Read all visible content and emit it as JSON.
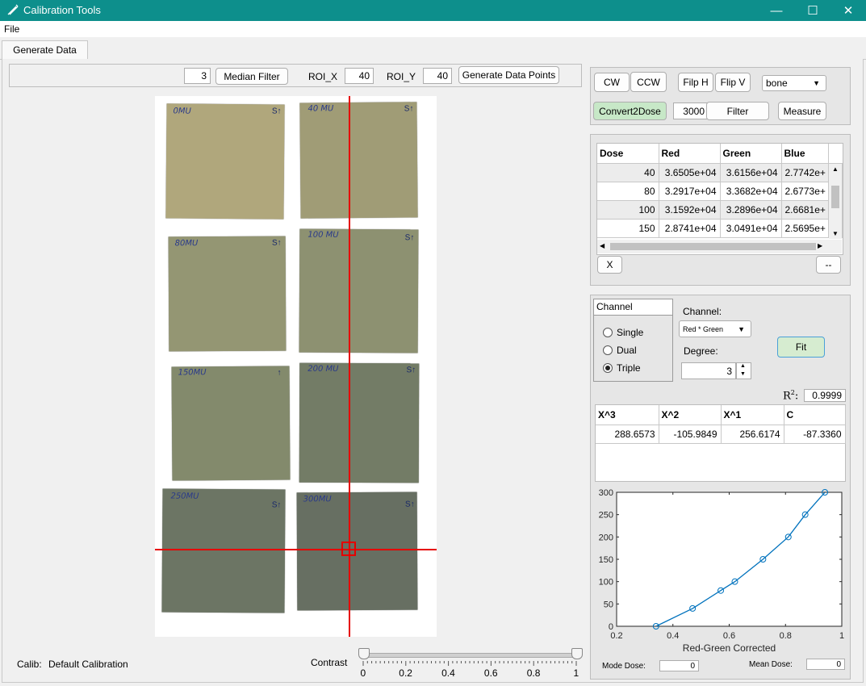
{
  "window": {
    "title": "Calibration Tools",
    "minimize": "—",
    "maximize": "☐",
    "close": "✕"
  },
  "menu": {
    "file": "File"
  },
  "tabs": [
    {
      "label": "Generate Data"
    }
  ],
  "toolbar": {
    "median_value": "3",
    "median_filter": "Median Filter",
    "roi_x_label": "ROI_X",
    "roi_x_value": "40",
    "roi_y_label": "ROI_Y",
    "roi_y_value": "40",
    "generate_points": "Generate Data Points"
  },
  "films": [
    {
      "label": "0MU",
      "arrow": "S↑"
    },
    {
      "label": "40 MU",
      "arrow": "S↑"
    },
    {
      "label": "80MU",
      "arrow": "S↑"
    },
    {
      "label": "100 MU",
      "arrow": "S↑"
    },
    {
      "label": "150MU",
      "arrow": "↑"
    },
    {
      "label": "200 MU",
      "arrow": "S↑"
    },
    {
      "label": "250MU",
      "arrow": "S↑"
    },
    {
      "label": "300MU",
      "arrow": "S↑"
    }
  ],
  "status": {
    "calib_label": "Calib:",
    "calib_value": "Default Calibration",
    "contrast_label": "Contrast",
    "contrast_ticks": [
      "0",
      "0.2",
      "0.4",
      "0.6",
      "0.8",
      "1"
    ],
    "contrast_low": 0,
    "contrast_high": 1
  },
  "controls": {
    "cw": "CW",
    "ccw": "CCW",
    "flip_h": "Filp H",
    "flip_v": "Flip V",
    "colormap": "bone",
    "convert": "Convert2Dose",
    "filter_value": "3000",
    "filter": "Filter",
    "measure": "Measure"
  },
  "dose_table": {
    "columns": [
      "Dose",
      "Red",
      "Green",
      "Blue"
    ],
    "rows": [
      [
        "40",
        "3.6505e+04",
        "3.6156e+04",
        "2.7742e+"
      ],
      [
        "80",
        "3.2917e+04",
        "3.3682e+04",
        "2.6773e+"
      ],
      [
        "100",
        "3.1592e+04",
        "3.2896e+04",
        "2.6681e+"
      ],
      [
        "150",
        "2.8741e+04",
        "3.0491e+04",
        "2.5695e+"
      ]
    ],
    "delete_button": "X",
    "more_button": "--"
  },
  "fit": {
    "channel_group_title": "Channel",
    "modes": [
      "Single",
      "Dual",
      "Triple"
    ],
    "selected_mode": "Triple",
    "channel_label": "Channel:",
    "channel_value": "Red * Green",
    "degree_label": "Degree:",
    "degree_value": "3",
    "fit_button": "Fit",
    "r2_label": "R",
    "r2_sup": "2",
    "r2_colon": ":",
    "r2_value": "0.9999",
    "coef_columns": [
      "X^3",
      "X^2",
      "X^1",
      "C"
    ],
    "coef_values": [
      "288.6573",
      "-105.9849",
      "256.6174",
      "-87.3360"
    ]
  },
  "chart_data": {
    "type": "line",
    "title": "",
    "xlabel": "Red-Green Corrected",
    "ylabel": "",
    "xlim": [
      0.2,
      1
    ],
    "ylim": [
      0,
      300
    ],
    "xticks": [
      "0.2",
      "0.4",
      "0.6",
      "0.8",
      "1"
    ],
    "yticks": [
      "0",
      "50",
      "100",
      "150",
      "200",
      "250",
      "300"
    ],
    "points": [
      {
        "x": 0.34,
        "y": 0
      },
      {
        "x": 0.47,
        "y": 40
      },
      {
        "x": 0.57,
        "y": 80
      },
      {
        "x": 0.62,
        "y": 100
      },
      {
        "x": 0.72,
        "y": 150
      },
      {
        "x": 0.81,
        "y": 200
      },
      {
        "x": 0.87,
        "y": 250
      },
      {
        "x": 0.94,
        "y": 300
      }
    ],
    "line_color": "#0072bd"
  },
  "dose_readouts": {
    "mode_label": "Mode Dose:",
    "mode_value": "0",
    "mean_label": "Mean Dose:",
    "mean_value": "0"
  }
}
